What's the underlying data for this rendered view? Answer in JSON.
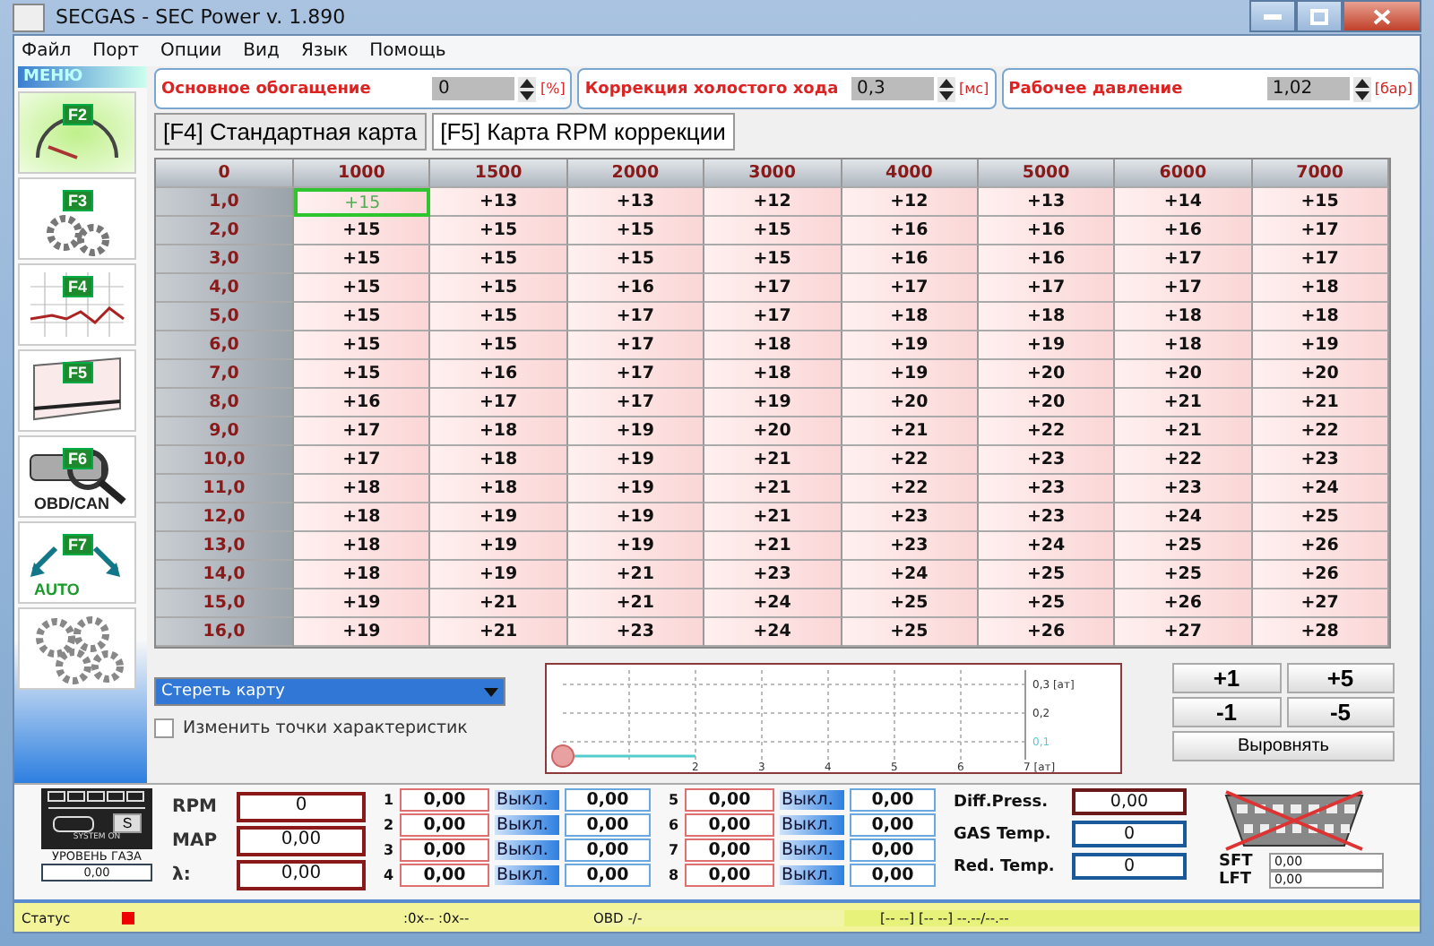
{
  "window": {
    "title": "SECGAS - SEC Power v. 1.890"
  },
  "menu": [
    "Файл",
    "Порт",
    "Опции",
    "Вид",
    "Язык",
    "Помощь"
  ],
  "params": [
    {
      "label": "Основное обогащение",
      "value": "0",
      "unit": "[%]"
    },
    {
      "label": "Коррекция холостого хода",
      "value": "0,3",
      "unit": "[мс]"
    },
    {
      "label": "Рабочее давление",
      "value": "1,02",
      "unit": "[бар]"
    }
  ],
  "tabs": [
    {
      "label": "[F4] Стандартная карта",
      "selected": false
    },
    {
      "label": "[F5] Карта RPM коррекции",
      "selected": true
    }
  ],
  "sidebar": {
    "title": "МЕНЮ",
    "items": [
      {
        "kind": "gauge",
        "key": "F2",
        "selected": true
      },
      {
        "kind": "gears",
        "key": "F3",
        "selected": false
      },
      {
        "kind": "graph",
        "key": "F4",
        "selected": false
      },
      {
        "kind": "map",
        "key": "F5",
        "selected": false
      },
      {
        "kind": "obd",
        "key": "F6",
        "caption": "OBD/CAN",
        "selected": false
      },
      {
        "kind": "auto",
        "key": "F7",
        "caption": "AUTO",
        "selected": false
      },
      {
        "kind": "many-gears",
        "selected": false
      }
    ]
  },
  "table": {
    "corner": "0",
    "columns": [
      "1000",
      "1500",
      "2000",
      "3000",
      "4000",
      "5000",
      "6000",
      "7000"
    ],
    "rows": [
      {
        "label": "1,0",
        "cells": [
          {
            "v": "+15",
            "selected": true
          },
          {
            "v": "+13",
            "selected": false
          },
          {
            "v": "+13",
            "selected": false
          },
          {
            "v": "+12",
            "selected": false
          },
          {
            "v": "+12",
            "selected": false
          },
          {
            "v": "+13",
            "selected": false
          },
          {
            "v": "+14",
            "selected": false
          },
          {
            "v": "+15",
            "selected": false
          }
        ]
      },
      {
        "label": "2,0",
        "cells": [
          {
            "v": "+15",
            "selected": false
          },
          {
            "v": "+15",
            "selected": false
          },
          {
            "v": "+15",
            "selected": false
          },
          {
            "v": "+15",
            "selected": false
          },
          {
            "v": "+16",
            "selected": false
          },
          {
            "v": "+16",
            "selected": false
          },
          {
            "v": "+16",
            "selected": false
          },
          {
            "v": "+17",
            "selected": false
          }
        ]
      },
      {
        "label": "3,0",
        "cells": [
          {
            "v": "+15",
            "selected": false
          },
          {
            "v": "+15",
            "selected": false
          },
          {
            "v": "+15",
            "selected": false
          },
          {
            "v": "+15",
            "selected": false
          },
          {
            "v": "+16",
            "selected": false
          },
          {
            "v": "+16",
            "selected": false
          },
          {
            "v": "+17",
            "selected": false
          },
          {
            "v": "+17",
            "selected": false
          }
        ]
      },
      {
        "label": "4,0",
        "cells": [
          {
            "v": "+15",
            "selected": false
          },
          {
            "v": "+15",
            "selected": false
          },
          {
            "v": "+16",
            "selected": false
          },
          {
            "v": "+17",
            "selected": false
          },
          {
            "v": "+17",
            "selected": false
          },
          {
            "v": "+17",
            "selected": false
          },
          {
            "v": "+17",
            "selected": false
          },
          {
            "v": "+18",
            "selected": false
          }
        ]
      },
      {
        "label": "5,0",
        "cells": [
          {
            "v": "+15",
            "selected": false
          },
          {
            "v": "+15",
            "selected": false
          },
          {
            "v": "+17",
            "selected": false
          },
          {
            "v": "+17",
            "selected": false
          },
          {
            "v": "+18",
            "selected": false
          },
          {
            "v": "+18",
            "selected": false
          },
          {
            "v": "+18",
            "selected": false
          },
          {
            "v": "+18",
            "selected": false
          }
        ]
      },
      {
        "label": "6,0",
        "cells": [
          {
            "v": "+15",
            "selected": false
          },
          {
            "v": "+15",
            "selected": false
          },
          {
            "v": "+17",
            "selected": false
          },
          {
            "v": "+18",
            "selected": false
          },
          {
            "v": "+19",
            "selected": false
          },
          {
            "v": "+19",
            "selected": false
          },
          {
            "v": "+18",
            "selected": false
          },
          {
            "v": "+19",
            "selected": false
          }
        ]
      },
      {
        "label": "7,0",
        "cells": [
          {
            "v": "+15",
            "selected": false
          },
          {
            "v": "+16",
            "selected": false
          },
          {
            "v": "+17",
            "selected": false
          },
          {
            "v": "+18",
            "selected": false
          },
          {
            "v": "+19",
            "selected": false
          },
          {
            "v": "+20",
            "selected": false
          },
          {
            "v": "+20",
            "selected": false
          },
          {
            "v": "+20",
            "selected": false
          }
        ]
      },
      {
        "label": "8,0",
        "cells": [
          {
            "v": "+16",
            "selected": false
          },
          {
            "v": "+17",
            "selected": false
          },
          {
            "v": "+17",
            "selected": false
          },
          {
            "v": "+19",
            "selected": false
          },
          {
            "v": "+20",
            "selected": false
          },
          {
            "v": "+20",
            "selected": false
          },
          {
            "v": "+21",
            "selected": false
          },
          {
            "v": "+21",
            "selected": false
          }
        ]
      },
      {
        "label": "9,0",
        "cells": [
          {
            "v": "+17",
            "selected": false
          },
          {
            "v": "+18",
            "selected": false
          },
          {
            "v": "+19",
            "selected": false
          },
          {
            "v": "+20",
            "selected": false
          },
          {
            "v": "+21",
            "selected": false
          },
          {
            "v": "+22",
            "selected": false
          },
          {
            "v": "+21",
            "selected": false
          },
          {
            "v": "+22",
            "selected": false
          }
        ]
      },
      {
        "label": "10,0",
        "cells": [
          {
            "v": "+17",
            "selected": false
          },
          {
            "v": "+18",
            "selected": false
          },
          {
            "v": "+19",
            "selected": false
          },
          {
            "v": "+21",
            "selected": false
          },
          {
            "v": "+22",
            "selected": false
          },
          {
            "v": "+23",
            "selected": false
          },
          {
            "v": "+22",
            "selected": false
          },
          {
            "v": "+23",
            "selected": false
          }
        ]
      },
      {
        "label": "11,0",
        "cells": [
          {
            "v": "+18",
            "selected": false
          },
          {
            "v": "+18",
            "selected": false
          },
          {
            "v": "+19",
            "selected": false
          },
          {
            "v": "+21",
            "selected": false
          },
          {
            "v": "+22",
            "selected": false
          },
          {
            "v": "+23",
            "selected": false
          },
          {
            "v": "+23",
            "selected": false
          },
          {
            "v": "+24",
            "selected": false
          }
        ]
      },
      {
        "label": "12,0",
        "cells": [
          {
            "v": "+18",
            "selected": false
          },
          {
            "v": "+19",
            "selected": false
          },
          {
            "v": "+19",
            "selected": false
          },
          {
            "v": "+21",
            "selected": false
          },
          {
            "v": "+23",
            "selected": false
          },
          {
            "v": "+23",
            "selected": false
          },
          {
            "v": "+24",
            "selected": false
          },
          {
            "v": "+25",
            "selected": false
          }
        ]
      },
      {
        "label": "13,0",
        "cells": [
          {
            "v": "+18",
            "selected": false
          },
          {
            "v": "+19",
            "selected": false
          },
          {
            "v": "+19",
            "selected": false
          },
          {
            "v": "+21",
            "selected": false
          },
          {
            "v": "+23",
            "selected": false
          },
          {
            "v": "+24",
            "selected": false
          },
          {
            "v": "+25",
            "selected": false
          },
          {
            "v": "+26",
            "selected": false
          }
        ]
      },
      {
        "label": "14,0",
        "cells": [
          {
            "v": "+18",
            "selected": false
          },
          {
            "v": "+19",
            "selected": false
          },
          {
            "v": "+21",
            "selected": false
          },
          {
            "v": "+23",
            "selected": false
          },
          {
            "v": "+24",
            "selected": false
          },
          {
            "v": "+25",
            "selected": false
          },
          {
            "v": "+25",
            "selected": false
          },
          {
            "v": "+26",
            "selected": false
          }
        ]
      },
      {
        "label": "15,0",
        "cells": [
          {
            "v": "+19",
            "selected": false
          },
          {
            "v": "+21",
            "selected": false
          },
          {
            "v": "+21",
            "selected": false
          },
          {
            "v": "+24",
            "selected": false
          },
          {
            "v": "+25",
            "selected": false
          },
          {
            "v": "+25",
            "selected": false
          },
          {
            "v": "+26",
            "selected": false
          },
          {
            "v": "+27",
            "selected": false
          }
        ]
      },
      {
        "label": "16,0",
        "cells": [
          {
            "v": "+19",
            "selected": false
          },
          {
            "v": "+21",
            "selected": false
          },
          {
            "v": "+23",
            "selected": false
          },
          {
            "v": "+24",
            "selected": false
          },
          {
            "v": "+25",
            "selected": false
          },
          {
            "v": "+26",
            "selected": false
          },
          {
            "v": "+27",
            "selected": false
          },
          {
            "v": "+28",
            "selected": false
          }
        ]
      }
    ]
  },
  "map_action": {
    "value": "Стереть карту"
  },
  "edit_points": {
    "label": "Изменить точки характеристик",
    "checked": false
  },
  "mini_chart": {
    "x_labels": [
      "2",
      "3",
      "4",
      "5",
      "6",
      "7 [ат]"
    ],
    "y_labels": [
      "0,3 [ат]",
      "0,2",
      "0,1"
    ]
  },
  "step_buttons": [
    "+1",
    "+5",
    "-1",
    "-5"
  ],
  "level_button": "Выровнять",
  "gas_level": {
    "button": "S",
    "caption": "SYSTEM ON",
    "label": "УРОВЕНЬ ГАЗА",
    "value": "0,00"
  },
  "engine": [
    {
      "label": "RPM",
      "value": "0"
    },
    {
      "label": "MAP",
      "value": "0,00"
    },
    {
      "label": "λ:",
      "value": "0,00"
    }
  ],
  "injectors": [
    {
      "num": "1",
      "time": "0,00",
      "state": "Выкл.",
      "value": "0,00"
    },
    {
      "num": "2",
      "time": "0,00",
      "state": "Выкл.",
      "value": "0,00"
    },
    {
      "num": "3",
      "time": "0,00",
      "state": "Выкл.",
      "value": "0,00"
    },
    {
      "num": "4",
      "time": "0,00",
      "state": "Выкл.",
      "value": "0,00"
    },
    {
      "num": "5",
      "time": "0,00",
      "state": "Выкл.",
      "value": "0,00"
    },
    {
      "num": "6",
      "time": "0,00",
      "state": "Выкл.",
      "value": "0,00"
    },
    {
      "num": "7",
      "time": "0,00",
      "state": "Выкл.",
      "value": "0,00"
    },
    {
      "num": "8",
      "time": "0,00",
      "state": "Выкл.",
      "value": "0,00"
    }
  ],
  "sensors": [
    {
      "label": "Diff.Press.",
      "value": "0,00",
      "kind": "pressure"
    },
    {
      "label": "GAS Temp.",
      "value": "0",
      "kind": "temp"
    },
    {
      "label": "Red. Temp.",
      "value": "0",
      "kind": "temp"
    }
  ],
  "obd": {
    "connected": false,
    "trims": [
      {
        "label": "SFT",
        "value": "0,00"
      },
      {
        "label": "LFT",
        "value": "0,00"
      }
    ]
  },
  "status_bar": {
    "label": "Статус",
    "ports": ":0x-- :0x--",
    "obd": "OBD -/-",
    "extra": "[-- --] [-- --] --.--/--.--"
  }
}
